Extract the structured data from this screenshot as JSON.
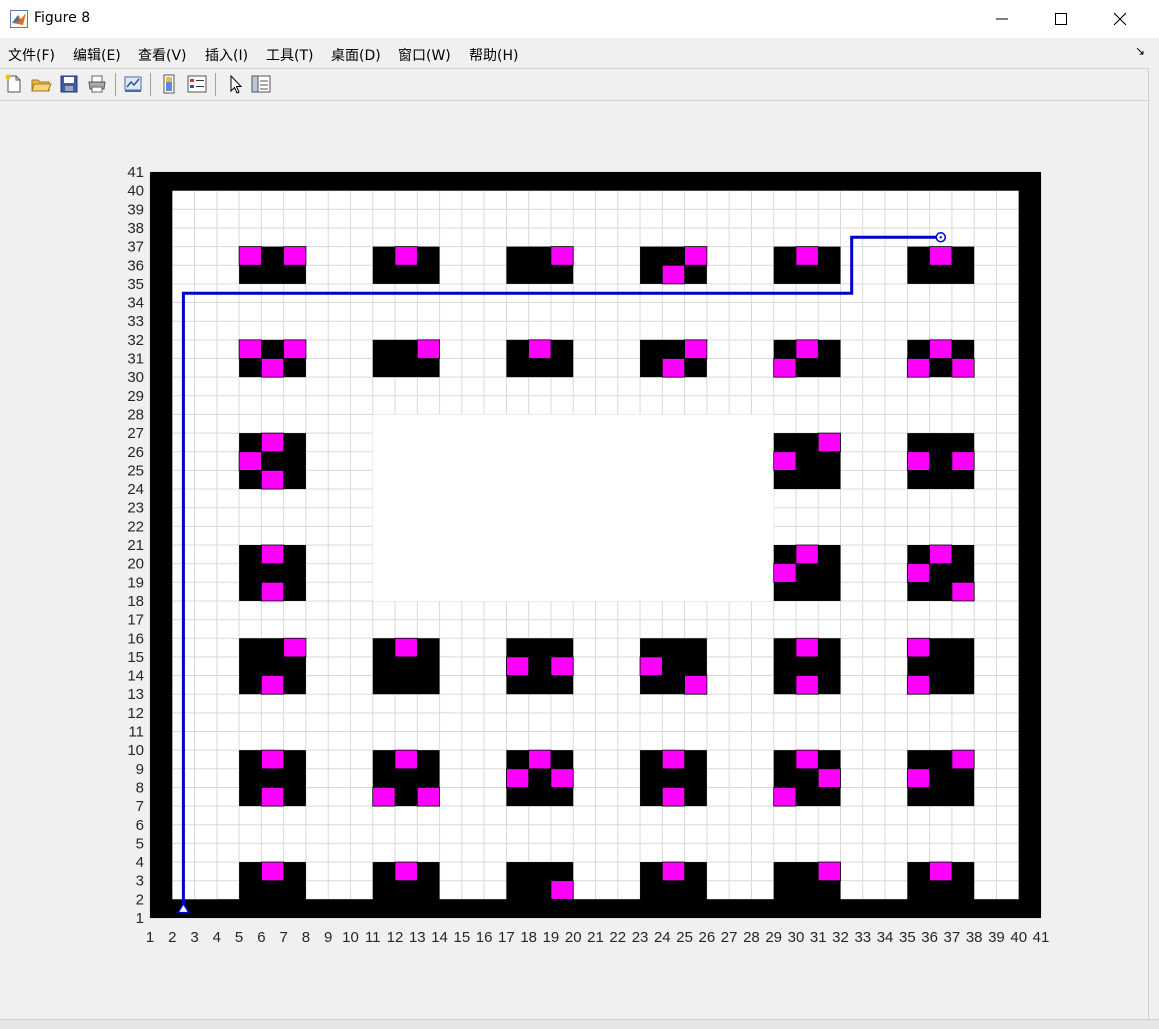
{
  "window": {
    "title": "Figure 8"
  },
  "window_controls": {
    "minimize": "—",
    "maximize": "☐",
    "close": "✕"
  },
  "menu": {
    "items": [
      {
        "label": "文件(F)"
      },
      {
        "label": "编辑(E)"
      },
      {
        "label": "查看(V)"
      },
      {
        "label": "插入(I)"
      },
      {
        "label": "工具(T)"
      },
      {
        "label": "桌面(D)"
      },
      {
        "label": "窗口(W)"
      },
      {
        "label": "帮助(H)"
      }
    ],
    "dock_glyph": "↘"
  },
  "toolbar": {
    "icons": [
      "new-figure-icon",
      "open-file-icon",
      "save-icon",
      "print-icon",
      "link-plot-icon",
      "insert-colorbar-icon",
      "insert-legend-icon",
      "pointer-icon",
      "property-inspector-icon"
    ]
  },
  "colors": {
    "obstacle": "#000000",
    "shelf_item": "#ff00ff",
    "path": "#0000cc",
    "grid": "#d9d9d9"
  },
  "chart_data": {
    "type": "grid-map",
    "xlim": [
      1,
      41
    ],
    "ylim": [
      1,
      41
    ],
    "xticks": [
      "1",
      "2",
      "3",
      "4",
      "5",
      "6",
      "7",
      "8",
      "9",
      "10",
      "11",
      "12",
      "13",
      "14",
      "15",
      "16",
      "17",
      "18",
      "19",
      "20",
      "21",
      "22",
      "23",
      "24",
      "25",
      "26",
      "27",
      "28",
      "29",
      "30",
      "31",
      "32",
      "33",
      "34",
      "35",
      "36",
      "37",
      "38",
      "39",
      "40",
      "41"
    ],
    "yticks": [
      "1",
      "2",
      "3",
      "4",
      "5",
      "6",
      "7",
      "8",
      "9",
      "10",
      "11",
      "12",
      "13",
      "14",
      "15",
      "16",
      "17",
      "18",
      "19",
      "20",
      "21",
      "22",
      "23",
      "24",
      "25",
      "26",
      "27",
      "28",
      "29",
      "30",
      "31",
      "32",
      "33",
      "34",
      "35",
      "36",
      "37",
      "38",
      "39",
      "40",
      "41"
    ],
    "grid": true,
    "obstacles": [
      [
        1,
        41,
        1,
        2
      ],
      [
        1,
        41,
        40,
        41
      ],
      [
        1,
        2,
        1,
        41
      ],
      [
        40,
        41,
        1,
        41
      ],
      [
        4,
        41,
        1,
        2
      ],
      [
        5,
        8,
        1,
        4
      ],
      [
        11,
        14,
        1,
        4
      ],
      [
        17,
        20,
        1,
        4
      ],
      [
        23,
        26,
        1,
        4
      ],
      [
        29,
        32,
        1,
        4
      ],
      [
        35,
        38,
        1,
        4
      ],
      [
        5,
        8,
        7,
        10
      ],
      [
        11,
        14,
        7,
        10
      ],
      [
        17,
        20,
        7,
        10
      ],
      [
        23,
        26,
        7,
        10
      ],
      [
        29,
        32,
        7,
        10
      ],
      [
        35,
        38,
        7,
        10
      ],
      [
        5,
        8,
        13,
        16
      ],
      [
        11,
        14,
        13,
        16
      ],
      [
        17,
        20,
        13,
        16
      ],
      [
        23,
        26,
        13,
        16
      ],
      [
        29,
        32,
        13,
        16
      ],
      [
        35,
        38,
        13,
        16
      ],
      [
        5,
        8,
        18,
        21
      ],
      [
        29,
        32,
        18,
        21
      ],
      [
        35,
        38,
        18,
        21
      ],
      [
        5,
        8,
        24,
        27
      ],
      [
        29,
        32,
        24,
        27
      ],
      [
        35,
        38,
        24,
        27
      ],
      [
        5,
        8,
        30,
        32
      ],
      [
        11,
        14,
        30,
        32
      ],
      [
        17,
        20,
        30,
        32
      ],
      [
        23,
        26,
        30,
        32
      ],
      [
        29,
        32,
        30,
        32
      ],
      [
        35,
        38,
        30,
        32
      ],
      [
        5,
        8,
        35,
        37
      ],
      [
        11,
        14,
        35,
        37
      ],
      [
        17,
        20,
        35,
        37
      ],
      [
        23,
        26,
        35,
        37
      ],
      [
        29,
        32,
        35,
        37
      ],
      [
        35,
        38,
        35,
        37
      ]
    ],
    "no_grid_zone": [
      11,
      29,
      18,
      28
    ],
    "items": [
      [
        6,
        3
      ],
      [
        12,
        3
      ],
      [
        19,
        2
      ],
      [
        24,
        3
      ],
      [
        31,
        3
      ],
      [
        36,
        3
      ],
      [
        6,
        9
      ],
      [
        6,
        7
      ],
      [
        12,
        9
      ],
      [
        11,
        7
      ],
      [
        13,
        7
      ],
      [
        18,
        9
      ],
      [
        17,
        8
      ],
      [
        19,
        8
      ],
      [
        24,
        9
      ],
      [
        24,
        7
      ],
      [
        30,
        9
      ],
      [
        31,
        8
      ],
      [
        29,
        7
      ],
      [
        37,
        9
      ],
      [
        35,
        8
      ],
      [
        7,
        15
      ],
      [
        6,
        13
      ],
      [
        12,
        15
      ],
      [
        17,
        14
      ],
      [
        19,
        14
      ],
      [
        23,
        14
      ],
      [
        25,
        13
      ],
      [
        30,
        15
      ],
      [
        30,
        13
      ],
      [
        35,
        15
      ],
      [
        35,
        13
      ],
      [
        6,
        20
      ],
      [
        6,
        18
      ],
      [
        30,
        20
      ],
      [
        29,
        19
      ],
      [
        36,
        20
      ],
      [
        35,
        19
      ],
      [
        37,
        18
      ],
      [
        6,
        26
      ],
      [
        5,
        25
      ],
      [
        6,
        24
      ],
      [
        31,
        26
      ],
      [
        29,
        25
      ],
      [
        35,
        25
      ],
      [
        37,
        25
      ],
      [
        5,
        31
      ],
      [
        7,
        31
      ],
      [
        6,
        30
      ],
      [
        13,
        31
      ],
      [
        18,
        31
      ],
      [
        25,
        31
      ],
      [
        24,
        30
      ],
      [
        30,
        31
      ],
      [
        29,
        30
      ],
      [
        36,
        31
      ],
      [
        35,
        30
      ],
      [
        37,
        30
      ],
      [
        5,
        36
      ],
      [
        7,
        36
      ],
      [
        12,
        36
      ],
      [
        19,
        36
      ],
      [
        25,
        36
      ],
      [
        24,
        35
      ],
      [
        30,
        36
      ],
      [
        36,
        36
      ]
    ],
    "path": [
      [
        2.5,
        1.5
      ],
      [
        2.5,
        34.5
      ],
      [
        32.5,
        34.5
      ],
      [
        32.5,
        37.5
      ],
      [
        36.5,
        37.5
      ]
    ],
    "start": [
      2.5,
      1.5
    ],
    "goal": [
      36.5,
      37.5
    ]
  }
}
